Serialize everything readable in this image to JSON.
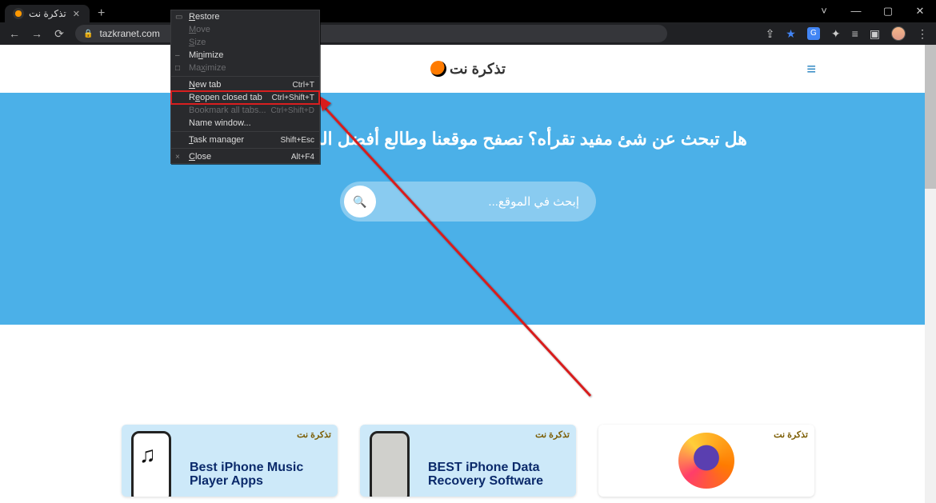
{
  "browser": {
    "tab_title": "تذكرة نت",
    "url": "tazkranet.com"
  },
  "window_controls": {
    "chevron": "˅",
    "min": "—",
    "max": "▢",
    "close": "✕"
  },
  "toolbar_icons": {
    "back": "←",
    "forward": "→",
    "reload": "⟳",
    "share": "⇪",
    "star": "★",
    "translate": "G",
    "ext": "✦",
    "list": "≡",
    "panel": "▣",
    "menu": "⋮"
  },
  "site": {
    "logo_text": "تذكرة نت",
    "hero_headline": "هل تبحث عن شئ مفيد تقرأه؟ تصفح موقعنا وطالع أفضل المقالات على الويب",
    "search_placeholder": "إبحث في الموقع..."
  },
  "cards": [
    {
      "title": "Best iPhone Music Player Apps",
      "badge": "تذكرة نت"
    },
    {
      "title": "BEST iPhone Data Recovery Software",
      "badge": "تذكرة نت"
    },
    {
      "title": "",
      "badge": "تذكرة نت"
    }
  ],
  "context_menu": {
    "items": [
      {
        "label": "Restore",
        "u": 0,
        "enabled": true,
        "shortcut": "",
        "glyph": "▭"
      },
      {
        "label": "Move",
        "u": 0,
        "enabled": false,
        "shortcut": ""
      },
      {
        "label": "Size",
        "u": 0,
        "enabled": false,
        "shortcut": ""
      },
      {
        "label": "Minimize",
        "u": 2,
        "enabled": true,
        "shortcut": "",
        "glyph": "–"
      },
      {
        "label": "Maximize",
        "u": 2,
        "enabled": false,
        "shortcut": "",
        "glyph": "□"
      },
      {
        "sep": true
      },
      {
        "label": "New tab",
        "u": 0,
        "enabled": true,
        "shortcut": "Ctrl+T"
      },
      {
        "label": "Reopen closed tab",
        "u": 1,
        "enabled": true,
        "shortcut": "Ctrl+Shift+T",
        "highlight": true
      },
      {
        "label": "Bookmark all tabs...",
        "u": -1,
        "enabled": false,
        "shortcut": "Ctrl+Shift+D"
      },
      {
        "label": "Name window...",
        "u": -1,
        "enabled": true,
        "shortcut": ""
      },
      {
        "sep": true
      },
      {
        "label": "Task manager",
        "u": 0,
        "enabled": true,
        "shortcut": "Shift+Esc"
      },
      {
        "sep": true
      },
      {
        "label": "Close",
        "u": 0,
        "enabled": true,
        "shortcut": "Alt+F4",
        "glyph": "×"
      }
    ]
  }
}
